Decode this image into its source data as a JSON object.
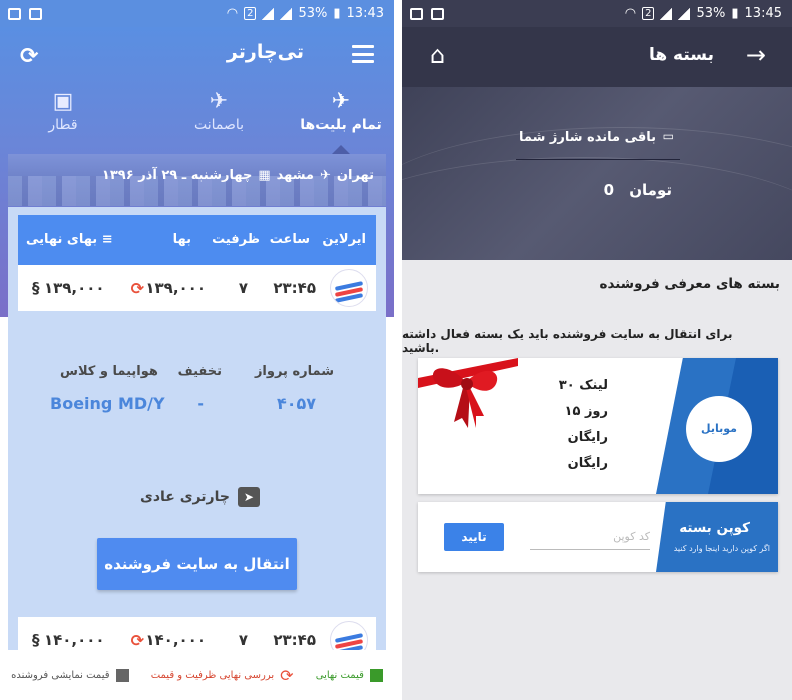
{
  "left_phone": {
    "status": {
      "time": "13:43",
      "battery": "53%",
      "sim": "2"
    },
    "app_title": "تی‌چارتر",
    "tabs": [
      {
        "label": "تمام بلیت‌ها",
        "icon": "airplane-icon",
        "active": true
      },
      {
        "label": "باصمانت",
        "icon": "airplane-icon",
        "active": false
      },
      {
        "label": "قطار",
        "icon": "train-icon",
        "active": false
      }
    ],
    "route": {
      "from": "تهران",
      "to": "مشهد",
      "date": "چهارشنبه ـ ۲۹ آذر ۱۳۹۶"
    },
    "table_headers": {
      "airline": "ایرلاین",
      "time": "ساعت",
      "capacity": "ظرفیت",
      "price": "بها",
      "final_price": "بهای نهایی"
    },
    "rows": [
      {
        "time": "۲۳:۴۵",
        "capacity": "۷",
        "price": "۱۳۹,۰۰۰",
        "final_price": "۱۳۹,۰۰۰"
      },
      {
        "time": "۲۳:۴۵",
        "capacity": "۷",
        "price": "۱۴۰,۰۰۰",
        "final_price": "۱۴۰,۰۰۰"
      }
    ],
    "detail": {
      "flight_no_label": "شماره پرواز",
      "flight_no": "۴۰۵۷",
      "discount_label": "تخفیف",
      "discount": "-",
      "aircraft_label": "هواپیما و کلاس",
      "aircraft": "Boeing MD/Y",
      "charter_type": "چارتری عادی",
      "go_button": "انتقال به سایت فروشنده"
    },
    "legend": [
      {
        "label": "قیمت نمایشی فروشنده",
        "color": "#666666"
      },
      {
        "label": "بررسی نهایی ظرفیت و قیمت",
        "color": "#e9513b"
      },
      {
        "label": "قیمت نهایی",
        "color": "#3a9a2a"
      }
    ]
  },
  "right_phone": {
    "status": {
      "time": "13:45",
      "battery": "53%",
      "sim": "2"
    },
    "title": "بسته ها",
    "credit_label": "باقی مانده شارژ شما",
    "credit_amount": "0",
    "credit_unit": "تومان",
    "packages_title": "بسته های معرفی فروشنده",
    "packages_note": "برای انتقال به سایت فروشنده باید یک بسته فعال داشته باشید.",
    "package": {
      "badge": "موبایل",
      "features": [
        "۳۰ لینک",
        "۱۵ روز",
        "رایگان",
        "رایگان"
      ]
    },
    "coupon": {
      "title": "کوپن بسته",
      "subtitle": "اگر کوپن دارید اینجا وارد کنید",
      "placeholder": "کد کوپن",
      "button": "تایید"
    }
  }
}
